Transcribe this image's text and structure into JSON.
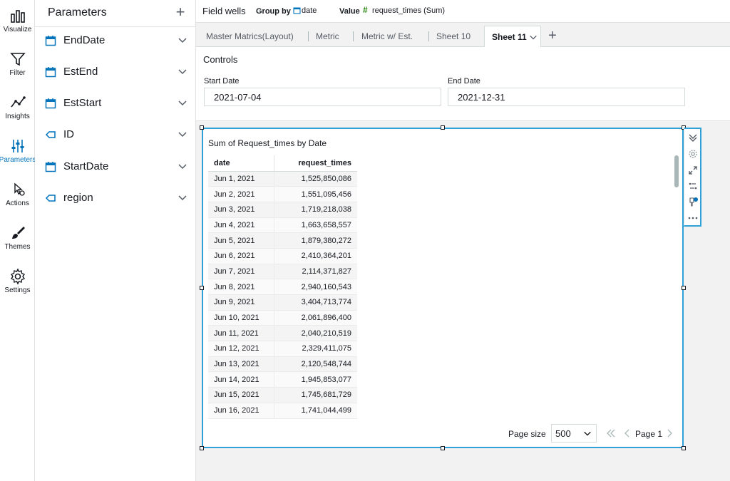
{
  "rail": {
    "items": [
      {
        "label": "Visualize"
      },
      {
        "label": "Filter"
      },
      {
        "label": "Insights"
      },
      {
        "label": "Parameters"
      },
      {
        "label": "Actions"
      },
      {
        "label": "Themes"
      },
      {
        "label": "Settings"
      }
    ]
  },
  "params": {
    "title": "Parameters",
    "add_label": "+",
    "items": [
      {
        "label": "EndDate",
        "icon": "calendar-icon"
      },
      {
        "label": "EstEnd",
        "icon": "calendar-icon"
      },
      {
        "label": "EstStart",
        "icon": "calendar-icon"
      },
      {
        "label": "ID",
        "icon": "tag-icon"
      },
      {
        "label": "StartDate",
        "icon": "calendar-icon"
      },
      {
        "label": "region",
        "icon": "tag-icon"
      }
    ]
  },
  "fieldwells": {
    "title": "Field wells",
    "groupby_label": "Group by",
    "groupby_value": "date",
    "value_label": "Value",
    "value_icon": "#",
    "value_value": "request_times (Sum)"
  },
  "tabs": {
    "items": [
      {
        "label": "Master Matrics(Layout)"
      },
      {
        "label": "Metric"
      },
      {
        "label": "Metric w/ Est."
      },
      {
        "label": "Sheet 10"
      },
      {
        "label": "Sheet 11"
      }
    ],
    "active": "Sheet 11",
    "add_label": "+"
  },
  "controls": {
    "title": "Controls",
    "start_label": "Start Date",
    "start_value": "2021-07-04",
    "end_label": "End Date",
    "end_value": "2021-12-31"
  },
  "visual": {
    "title": "Sum of Request_times by Date",
    "columns": [
      "date",
      "request_times"
    ],
    "rows": [
      [
        "Jun 1, 2021",
        "1,525,850,086"
      ],
      [
        "Jun 2, 2021",
        "1,551,095,456"
      ],
      [
        "Jun 3, 2021",
        "1,719,218,038"
      ],
      [
        "Jun 4, 2021",
        "1,663,658,557"
      ],
      [
        "Jun 5, 2021",
        "1,879,380,272"
      ],
      [
        "Jun 6, 2021",
        "2,410,364,201"
      ],
      [
        "Jun 7, 2021",
        "2,114,371,827"
      ],
      [
        "Jun 8, 2021",
        "2,940,160,543"
      ],
      [
        "Jun 9, 2021",
        "3,404,713,774"
      ],
      [
        "Jun 10, 2021",
        "2,061,896,400"
      ],
      [
        "Jun 11, 2021",
        "2,040,210,519"
      ],
      [
        "Jun 12, 2021",
        "2,329,411,075"
      ],
      [
        "Jun 13, 2021",
        "2,120,548,744"
      ],
      [
        "Jun 14, 2021",
        "1,945,853,077"
      ],
      [
        "Jun 15, 2021",
        "1,745,681,729"
      ],
      [
        "Jun 16, 2021",
        "1,741,044,499"
      ]
    ],
    "page_size_label": "Page size",
    "page_size_value": "500",
    "page_label": "Page 1"
  },
  "colors": {
    "accent": "#0073bb",
    "selection_border": "#2fa1d6",
    "measure_green": "#1d8102"
  }
}
